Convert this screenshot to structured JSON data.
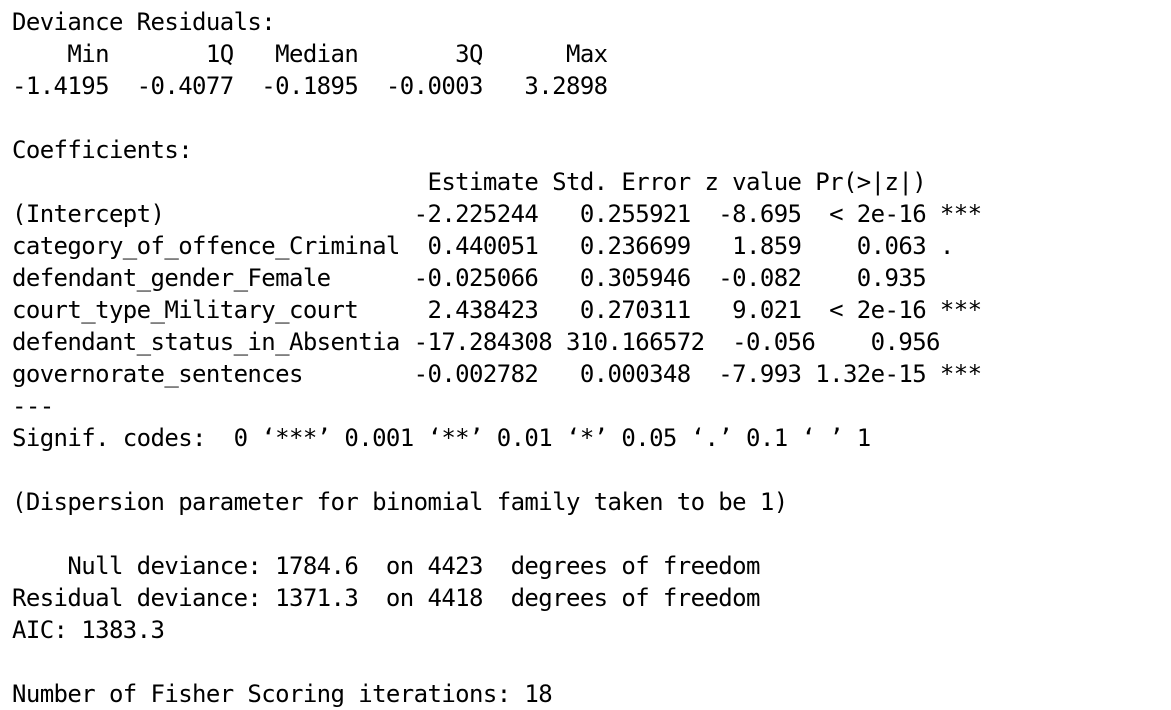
{
  "output": {
    "lines": [
      "Deviance Residuals: ",
      "    Min       1Q   Median       3Q      Max  ",
      "-1.4195  -0.4077  -0.1895  -0.0003   3.2898  ",
      "",
      "Coefficients:",
      "                              Estimate Std. Error z value Pr(>|z|)    ",
      "(Intercept)                  -2.225244   0.255921  -8.695  < 2e-16 ***",
      "category_of_offence_Criminal  0.440051   0.236699   1.859    0.063 .  ",
      "defendant_gender_Female      -0.025066   0.305946  -0.082    0.935    ",
      "court_type_Military_court     2.438423   0.270311   9.021  < 2e-16 ***",
      "defendant_status_in_Absentia -17.284308 310.166572  -0.056    0.956    ",
      "governorate_sentences        -0.002782   0.000348  -7.993 1.32e-15 ***",
      "---",
      "Signif. codes:  0 ‘***’ 0.001 ‘**’ 0.01 ‘*’ 0.05 ‘.’ 0.1 ‘ ’ 1",
      "",
      "(Dispersion parameter for binomial family taken to be 1)",
      "",
      "    Null deviance: 1784.6  on 4423  degrees of freedom",
      "Residual deviance: 1371.3  on 4418  degrees of freedom",
      "AIC: 1383.3",
      "",
      "Number of Fisher Scoring iterations: 18"
    ]
  }
}
